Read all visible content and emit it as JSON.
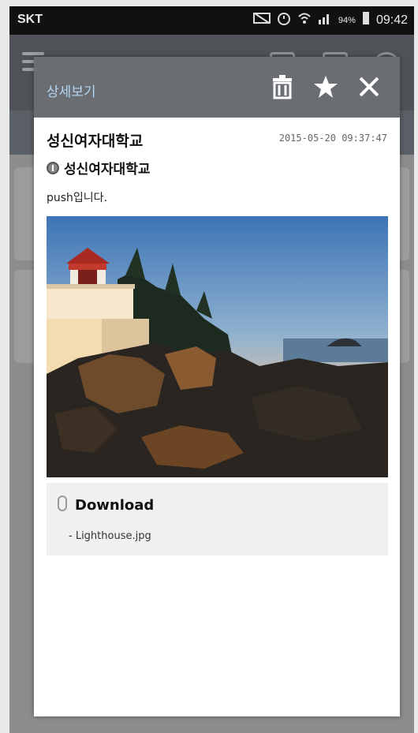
{
  "status_bar": {
    "carrier": "SKT",
    "battery": "94%",
    "time": "09:42"
  },
  "dialog": {
    "header_title": "상세보기",
    "actions": [
      {
        "name": "delete",
        "icon": "trash-icon"
      },
      {
        "name": "favorite",
        "icon": "star-icon"
      },
      {
        "name": "close",
        "icon": "close-icon"
      }
    ],
    "title": "성신여자대학교",
    "date": "2015-05-20 09:37:47",
    "sender": "성신여자대학교",
    "body": "push입니다.",
    "image_alt": "lighthouse photo",
    "attachment": {
      "download_label": "Download",
      "file_name": "- Lighthouse.jpg",
      "icon": "paperclip-icon"
    }
  },
  "colors": {
    "header_bg": "#6a6e73",
    "header_title": "#b3d4f1",
    "attachment_bg": "#f0f0f0",
    "status_bg": "#111111"
  }
}
